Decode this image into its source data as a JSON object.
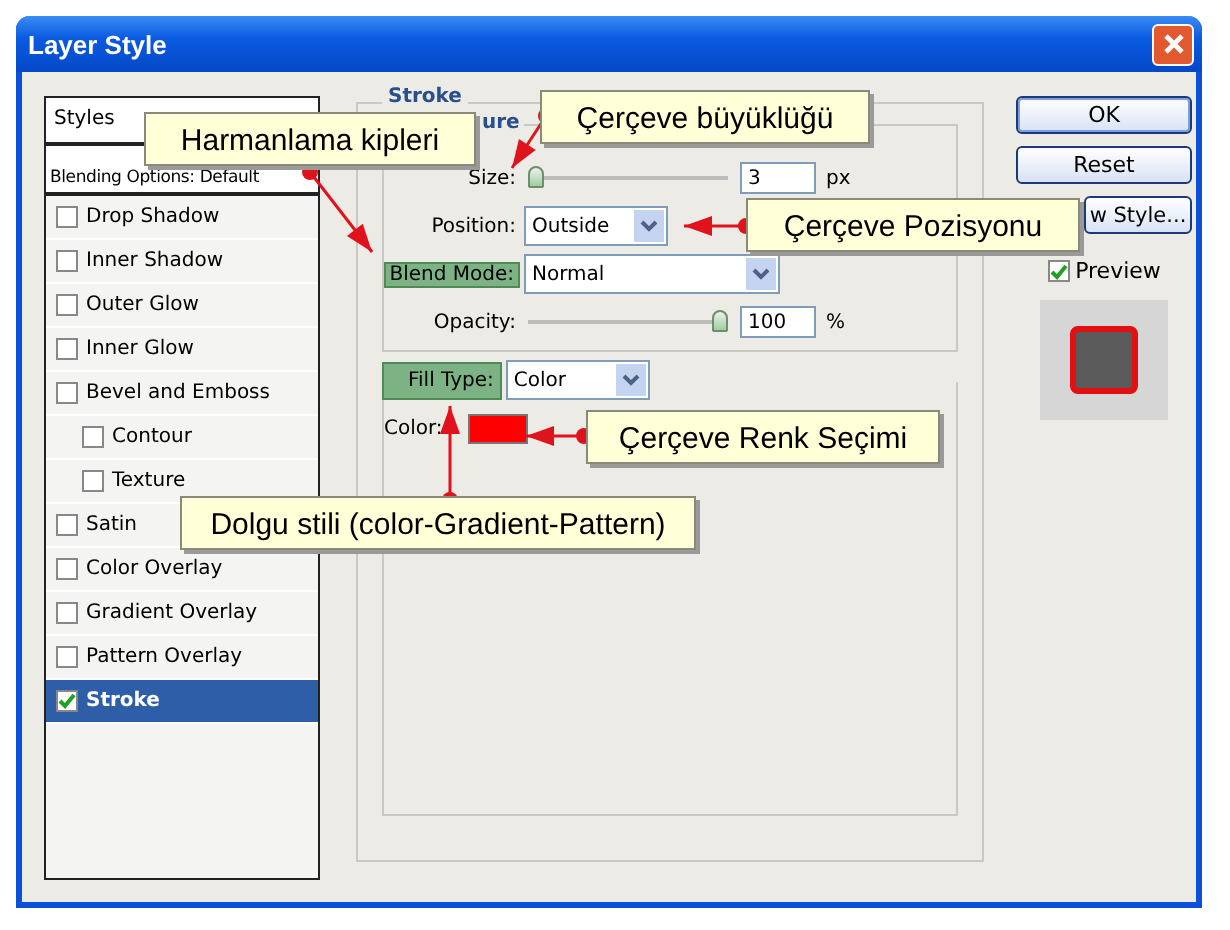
{
  "window": {
    "title": "Layer Style"
  },
  "styles_panel": {
    "header": "Styles",
    "blending_options": "Blending Options: Default",
    "items": [
      {
        "label": "Drop Shadow",
        "checked": false,
        "selected": false
      },
      {
        "label": "Inner Shadow",
        "checked": false,
        "selected": false
      },
      {
        "label": "Outer Glow",
        "checked": false,
        "selected": false
      },
      {
        "label": "Inner Glow",
        "checked": false,
        "selected": false
      },
      {
        "label": "Bevel and Emboss",
        "checked": false,
        "selected": false,
        "children": [
          {
            "label": "Contour",
            "checked": false,
            "selected": false
          },
          {
            "label": "Texture",
            "checked": false,
            "selected": false
          }
        ]
      },
      {
        "label": "Satin",
        "checked": false,
        "selected": false
      },
      {
        "label": "Color Overlay",
        "checked": false,
        "selected": false
      },
      {
        "label": "Gradient Overlay",
        "checked": false,
        "selected": false
      },
      {
        "label": "Pattern Overlay",
        "checked": false,
        "selected": false
      },
      {
        "label": "Stroke",
        "checked": true,
        "selected": true
      }
    ]
  },
  "stroke": {
    "title": "Stroke",
    "structure_title": "ure",
    "size": {
      "label": "Size:",
      "highlighted": false,
      "value": "3",
      "unit": "px",
      "level": 0
    },
    "position": {
      "label": "Position:",
      "highlighted": false,
      "value": "Outside"
    },
    "blend_mode": {
      "label": "Blend Mode:",
      "highlighted": true,
      "value": "Normal"
    },
    "opacity": {
      "label": "Opacity:",
      "highlighted": false,
      "value": "100",
      "unit": "%",
      "level": 1
    },
    "fill_type": {
      "label": "Fill Type:",
      "highlighted": true,
      "value": "Color"
    },
    "color": {
      "label": "Color:",
      "highlighted": false,
      "color": "#ff0000"
    }
  },
  "buttons": [
    {
      "label": "OK",
      "default": true
    },
    {
      "label": "Reset",
      "default": false
    },
    {
      "label": "w Style...",
      "default": false
    }
  ],
  "preview": {
    "label": "Preview",
    "checked": true
  },
  "callouts": [
    {
      "text": "Harmanlama kipleri"
    },
    {
      "text": "Çerçeve büyüklüğü"
    },
    {
      "text": "Çerçeve Pozisyonu"
    },
    {
      "text": "Çerçeve Renk Seçimi"
    },
    {
      "text": "Dolgu stili (color-Gradient-Pattern)"
    }
  ]
}
